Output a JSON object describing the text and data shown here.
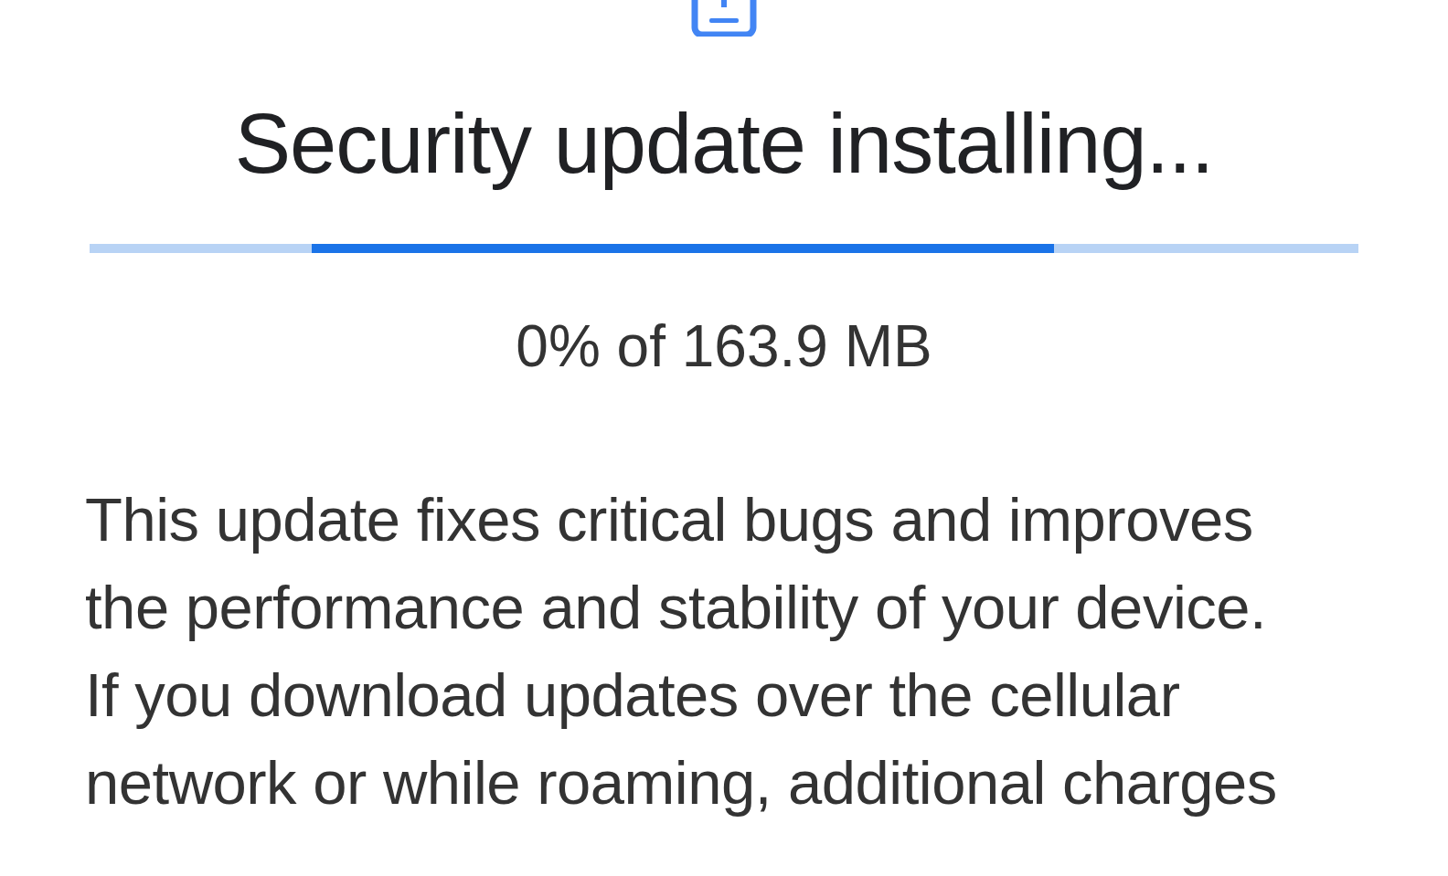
{
  "title": "Security update installing...",
  "progress_text": "0% of 163.9 MB",
  "description": "This update fixes critical bugs and improves\nthe performance and stability of your device.\nIf you download updates over the cellular\nnetwork or while roaming, additional charges"
}
